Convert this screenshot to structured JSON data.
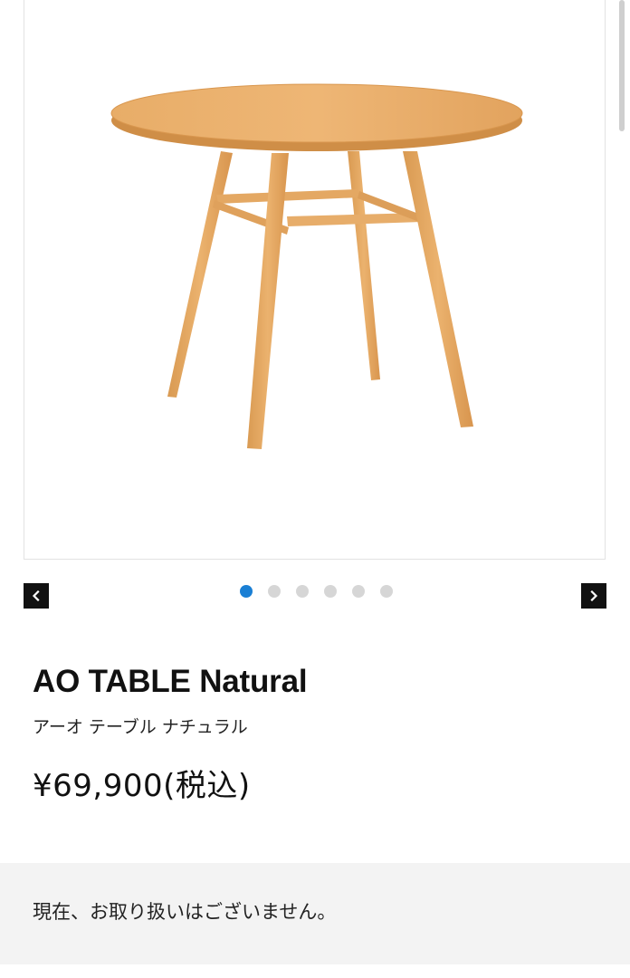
{
  "product": {
    "name": "AO TABLE Natural",
    "name_kana": "アーオ テーブル ナチュラル",
    "price": "¥69,900(税込)"
  },
  "gallery": {
    "total_images": 6,
    "active_index": 0,
    "prev_icon": "chevron-left-icon",
    "next_icon": "chevron-right-icon"
  },
  "availability": {
    "message": "現在、お取り扱いはございません。"
  },
  "colors": {
    "accent_dot": "#1a7fd4",
    "inactive_dot": "#d6d6d6",
    "nav_button": "#111111",
    "notice_background": "#f3f3f3",
    "wood": "#e3a864"
  }
}
